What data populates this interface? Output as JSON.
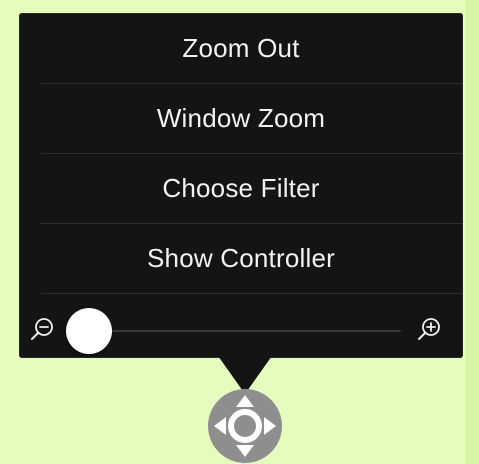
{
  "menu": {
    "items": [
      {
        "label": "Zoom Out"
      },
      {
        "label": "Window Zoom"
      },
      {
        "label": "Choose Filter"
      },
      {
        "label": "Show Controller"
      }
    ]
  },
  "zoom_slider": {
    "level": 0.0,
    "min_icon": "zoom-out-magnifier-icon",
    "max_icon": "zoom-in-magnifier-icon"
  },
  "controller": {
    "icon": "directional-pad-icon"
  },
  "colors": {
    "background": "#e6fcbe",
    "popover": "#141414",
    "menu_text": "#f2f2f2",
    "controller": "#8e8e8e"
  }
}
